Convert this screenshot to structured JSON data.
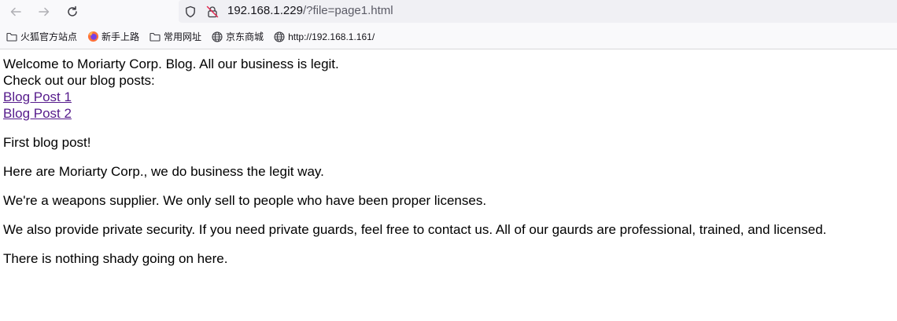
{
  "browser": {
    "url_host": "192.168.1.229",
    "url_path": "/?file=page1.html",
    "bookmarks": [
      {
        "label": "火狐官方站点",
        "icon": "folder-icon"
      },
      {
        "label": "新手上路",
        "icon": "firefox-icon"
      },
      {
        "label": "常用网址",
        "icon": "folder-icon"
      },
      {
        "label": "京东商城",
        "icon": "globe-icon"
      },
      {
        "label": "http://192.168.1.161/",
        "icon": "globe-icon"
      }
    ]
  },
  "page": {
    "welcome": "Welcome to Moriarty Corp. Blog. All our business is legit.",
    "check_out": "Check out our blog posts:",
    "links": [
      "Blog Post 1",
      "Blog Post 2"
    ],
    "paragraphs": [
      "First blog post!",
      "Here are Moriarty Corp., we do business the legit way.",
      "We're a weapons supplier. We only sell to people who have been proper licenses.",
      "We also provide private security. If you need private guards, feel free to contact us. All of our gaurds are professional, trained, and licensed.",
      "There is nothing shady going on here."
    ],
    "link_color": "#551a8b"
  }
}
